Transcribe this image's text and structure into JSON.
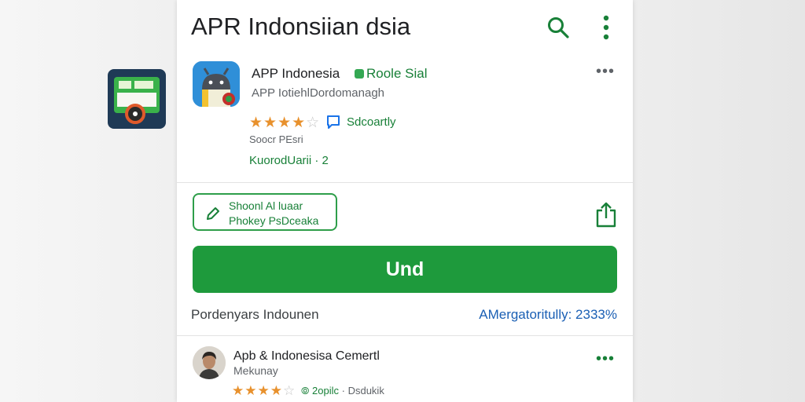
{
  "header": {
    "title": "APR Indonsiian dsia",
    "search_icon": "search-icon",
    "menu_icon": "more-vert-icon"
  },
  "app": {
    "name": "APP Indonesia",
    "badge": "Roole Sial",
    "developer": "APP IotiehlDordomanagh",
    "rating_stars": 4.5,
    "rating_label": "Sdcoartly",
    "size_text": "Soocr PEsri",
    "category": "KuorodUarii · 2"
  },
  "actions": {
    "outline_line1": "Shoonl Al luaar",
    "outline_line2": "Phokey PsDceaka",
    "install_label": "Und",
    "share_icon": "share-icon"
  },
  "info": {
    "left": "Pordenyars Indounen",
    "right": "AMergatoritully: 2333%"
  },
  "review": {
    "name": "Apb & Indonesisa Cemertl",
    "subtitle": "Mekunay",
    "stars": 4,
    "meta_green": "2opilc",
    "meta_grey": "Dsdukik"
  },
  "colors": {
    "accent": "#1e9a3c",
    "star": "#e8912d",
    "link": "#1a5fb4"
  }
}
